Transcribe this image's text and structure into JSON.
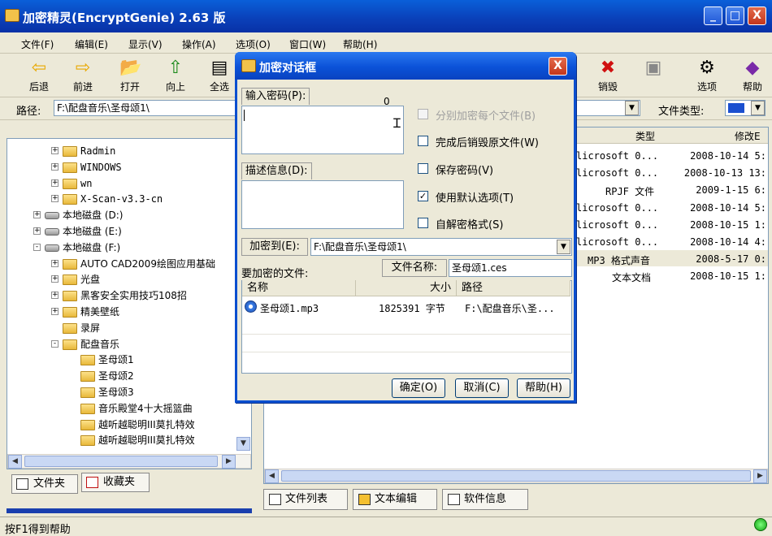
{
  "window": {
    "title": "加密精灵(EncryptGenie) 2.63 版",
    "min": "_",
    "max": "□",
    "close": "X"
  },
  "menu": [
    "文件(F)",
    "编辑(E)",
    "显示(V)",
    "操作(A)",
    "选项(O)",
    "窗口(W)",
    "帮助(H)"
  ],
  "toolbar": {
    "back": "后退",
    "forward": "前进",
    "open": "打开",
    "up": "向上",
    "select_all": "全选",
    "destroy": "销毁",
    "options": "选项",
    "help": "帮助"
  },
  "pathbar": {
    "label": "路径:",
    "value": "F:\\配盘音乐\\圣母颂1\\",
    "type_label": "文件类型:"
  },
  "tree": {
    "items": [
      {
        "label": "Radmin",
        "kind": "folder",
        "exp": "+"
      },
      {
        "label": "WINDOWS",
        "kind": "folder",
        "exp": "+"
      },
      {
        "label": "wn",
        "kind": "folder",
        "exp": "+"
      },
      {
        "label": "X-Scan-v3.3-cn",
        "kind": "folder",
        "exp": "+"
      },
      {
        "label": "本地磁盘 (D:)",
        "kind": "disk",
        "exp": "+"
      },
      {
        "label": "本地磁盘 (E:)",
        "kind": "disk",
        "exp": "+"
      },
      {
        "label": "本地磁盘 (F:)",
        "kind": "disk",
        "exp": "-"
      },
      {
        "label": "AUTO CAD2009绘图应用基础",
        "kind": "folder",
        "exp": "+"
      },
      {
        "label": "光盘",
        "kind": "folder",
        "exp": "+"
      },
      {
        "label": "黑客安全实用技巧108招",
        "kind": "folder",
        "exp": "+"
      },
      {
        "label": "精美壁纸",
        "kind": "folder",
        "exp": "+"
      },
      {
        "label": "录屏",
        "kind": "folder",
        "exp": ""
      },
      {
        "label": "配盘音乐",
        "kind": "folder",
        "exp": "-"
      },
      {
        "label": "圣母颂1",
        "kind": "folder",
        "exp": ""
      },
      {
        "label": "圣母颂2",
        "kind": "folder",
        "exp": ""
      },
      {
        "label": "圣母颂3",
        "kind": "folder",
        "exp": ""
      },
      {
        "label": "音乐殿堂4十大摇篮曲",
        "kind": "folder",
        "exp": ""
      },
      {
        "label": "越听越聪明III莫扎特效",
        "kind": "folder",
        "exp": ""
      },
      {
        "label": "越听越聪明III莫扎特效",
        "kind": "folder",
        "exp": ""
      }
    ]
  },
  "left_tabs": {
    "folders": "文件夹",
    "favorites": "收藏夹"
  },
  "list": {
    "col_type": "类型",
    "col_modified": "修改E",
    "rows": [
      {
        "type": "licrosoft 0...",
        "date": "2008-10-14 5:"
      },
      {
        "type": "licrosoft 0...",
        "date": "2008-10-13 13:"
      },
      {
        "type": "RPJF 文件",
        "date": "2009-1-15 6:"
      },
      {
        "type": "licrosoft 0...",
        "date": "2008-10-14 5:"
      },
      {
        "type": "licrosoft 0...",
        "date": "2008-10-15 1:"
      },
      {
        "type": "licrosoft 0...",
        "date": "2008-10-14 4:"
      },
      {
        "type": "MP3 格式声音",
        "date": "2008-5-17 0:"
      },
      {
        "type": "文本文档",
        "date": "2008-10-15 1:"
      }
    ]
  },
  "right_tabs": {
    "file_list": "文件列表",
    "text_edit": "文本编辑",
    "soft_info": "软件信息"
  },
  "status": {
    "text": "按F1得到帮助"
  },
  "dialog": {
    "title": "加密对话框",
    "close": "X",
    "password_label": "输入密码(P):",
    "password_count": "0",
    "desc_label": "描述信息(D):",
    "opt_separate": "分别加密每个文件(B)",
    "opt_destroy": "完成后销毁原文件(W)",
    "opt_save": "保存密码(V)",
    "opt_default": "使用默认选项(T)",
    "opt_self_extract": "自解密格式(S)",
    "encrypt_to_label": "加密到(E):",
    "encrypt_to_value": "F:\\配盘音乐\\圣母颂1\\",
    "files_label": "要加密的文件:",
    "filename_label": "文件名称:",
    "filename_value": "圣母颂1.ces",
    "col_name": "名称",
    "col_size": "大小",
    "col_path": "路径",
    "file_row": {
      "name": "圣母颂1.mp3",
      "size": "1825391 字节",
      "path": "F:\\配盘音乐\\圣..."
    },
    "ok": "确定(O)",
    "cancel": "取消(C)",
    "help": "帮助(H)"
  }
}
